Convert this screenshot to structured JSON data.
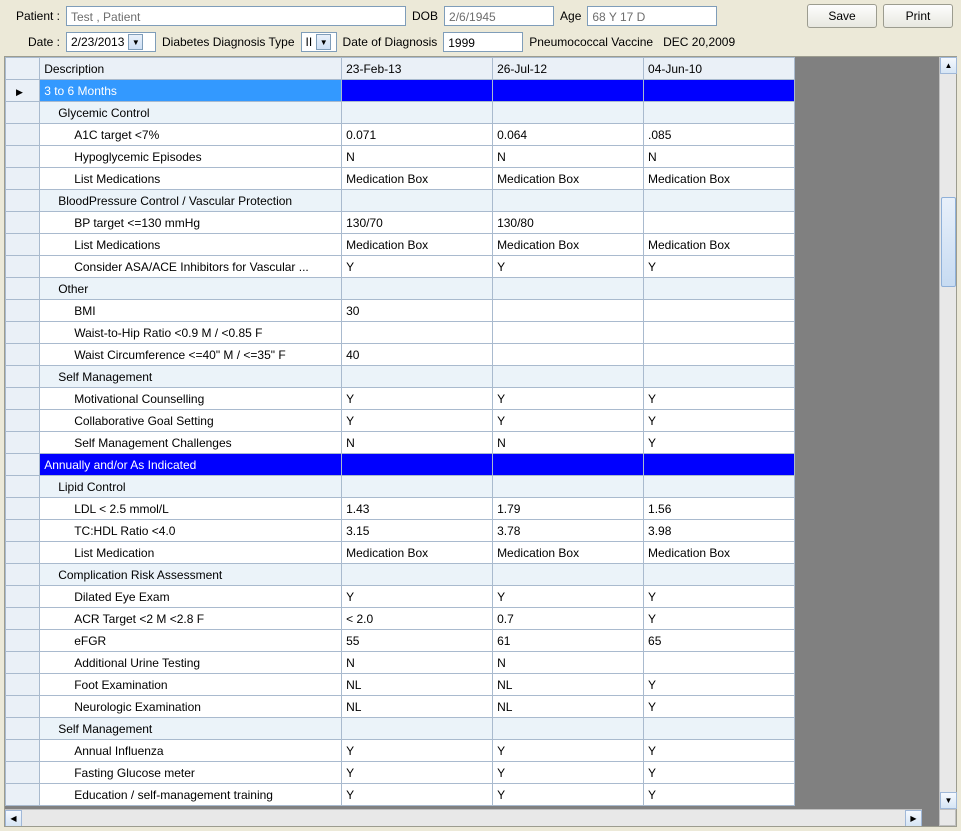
{
  "header": {
    "patient_label": "Patient :",
    "patient_value": "Test , Patient",
    "dob_label": "DOB",
    "dob_value": "2/6/1945",
    "age_label": "Age",
    "age_value": "68 Y 17 D",
    "save_label": "Save",
    "print_label": "Print",
    "date_label": "Date :",
    "date_value": "2/23/2013",
    "diag_type_label": "Diabetes Diagnosis Type",
    "diag_type_value": "II",
    "date_of_diag_label": "Date of Diagnosis",
    "date_of_diag_value": "1999",
    "pneumo_label": "Pneumococcal Vaccine",
    "pneumo_value": "DEC 20,2009"
  },
  "columns": {
    "desc": "Description",
    "d1": "23-Feb-13",
    "d2": "26-Jul-12",
    "d3": "04-Jun-10"
  },
  "rows": [
    {
      "type": "section1",
      "desc": "3 to 6 Months",
      "v": [
        "",
        "",
        ""
      ]
    },
    {
      "type": "sub",
      "desc": "Glycemic Control",
      "v": [
        "",
        "",
        ""
      ]
    },
    {
      "type": "data",
      "desc": "A1C target <7%",
      "v": [
        "0.071",
        "0.064",
        ".085"
      ]
    },
    {
      "type": "data",
      "desc": "Hypoglycemic Episodes",
      "v": [
        "N",
        "N",
        "N"
      ]
    },
    {
      "type": "data",
      "desc": "List Medications",
      "v": [
        "Medication Box",
        "Medication Box",
        "Medication Box"
      ]
    },
    {
      "type": "sub",
      "desc": "BloodPressure Control / Vascular Protection",
      "v": [
        "",
        "",
        ""
      ]
    },
    {
      "type": "data",
      "desc": "BP target <=130 mmHg",
      "v": [
        "130/70",
        "130/80",
        ""
      ]
    },
    {
      "type": "data",
      "desc": "List Medications",
      "v": [
        "Medication Box",
        "Medication Box",
        "Medication Box"
      ]
    },
    {
      "type": "data",
      "desc": "Consider ASA/ACE Inhibitors for Vascular ...",
      "v": [
        "Y",
        "Y",
        "Y"
      ]
    },
    {
      "type": "sub",
      "desc": "Other",
      "v": [
        "",
        "",
        ""
      ]
    },
    {
      "type": "data",
      "desc": "BMI",
      "v": [
        "30",
        "",
        ""
      ]
    },
    {
      "type": "data",
      "desc": "Waist-to-Hip Ratio <0.9 M / <0.85 F",
      "v": [
        "",
        "",
        ""
      ]
    },
    {
      "type": "data",
      "desc": "Waist Circumference <=40\" M / <=35\" F",
      "v": [
        "40",
        "",
        ""
      ]
    },
    {
      "type": "sub",
      "desc": "Self Management",
      "v": [
        "",
        "",
        ""
      ]
    },
    {
      "type": "data",
      "desc": "Motivational Counselling",
      "v": [
        "Y",
        "Y",
        "Y"
      ]
    },
    {
      "type": "data",
      "desc": "Collaborative Goal Setting",
      "v": [
        "Y",
        "Y",
        "Y"
      ]
    },
    {
      "type": "data",
      "desc": "Self Management Challenges",
      "v": [
        "N",
        "N",
        "Y"
      ]
    },
    {
      "type": "section2",
      "desc": "Annually and/or As Indicated",
      "v": [
        "",
        "",
        ""
      ]
    },
    {
      "type": "sub",
      "desc": "Lipid Control",
      "v": [
        "",
        "",
        ""
      ]
    },
    {
      "type": "data",
      "desc": "LDL < 2.5 mmol/L",
      "v": [
        "1.43",
        "1.79",
        "1.56"
      ]
    },
    {
      "type": "data",
      "desc": "TC:HDL Ratio <4.0",
      "v": [
        "3.15",
        "3.78",
        "3.98"
      ]
    },
    {
      "type": "data",
      "desc": "List Medication",
      "v": [
        "Medication Box",
        "Medication Box",
        "Medication Box"
      ]
    },
    {
      "type": "sub",
      "desc": "Complication Risk Assessment",
      "v": [
        "",
        "",
        ""
      ]
    },
    {
      "type": "data",
      "desc": "Dilated Eye Exam",
      "v": [
        "Y",
        "Y",
        "Y"
      ]
    },
    {
      "type": "data",
      "desc": "ACR Target <2 M <2.8 F",
      "v": [
        "< 2.0",
        "0.7",
        "Y"
      ]
    },
    {
      "type": "data",
      "desc": "eFGR",
      "v": [
        "55",
        "61",
        "65"
      ]
    },
    {
      "type": "data",
      "desc": "Additional Urine Testing",
      "v": [
        "N",
        "N",
        ""
      ]
    },
    {
      "type": "data",
      "desc": "Foot Examination",
      "v": [
        "NL",
        "NL",
        "Y"
      ]
    },
    {
      "type": "data",
      "desc": "Neurologic Examination",
      "v": [
        "NL",
        "NL",
        "Y"
      ]
    },
    {
      "type": "sub",
      "desc": "Self Management",
      "v": [
        "",
        "",
        ""
      ]
    },
    {
      "type": "data",
      "desc": "Annual Influenza",
      "v": [
        "Y",
        "Y",
        "Y"
      ]
    },
    {
      "type": "data",
      "desc": "Fasting Glucose meter",
      "v": [
        "Y",
        "Y",
        "Y"
      ]
    },
    {
      "type": "data",
      "desc": "Education / self-management training",
      "v": [
        "Y",
        "Y",
        "Y"
      ]
    }
  ]
}
